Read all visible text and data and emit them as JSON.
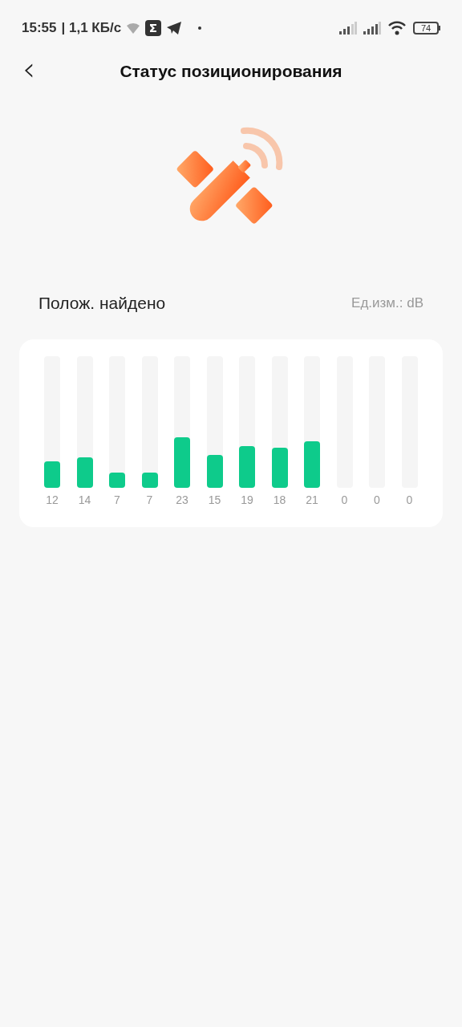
{
  "status_bar": {
    "time": "15:55",
    "speed": "| 1,1 КБ/с",
    "battery": "74"
  },
  "header": {
    "back": "‹",
    "title": "Статус позиционирования"
  },
  "status_row": {
    "label": "Полож. найдено",
    "unit": "Ед.изм.: dB"
  },
  "signal_card": {
    "satellites": [
      {
        "reading": "12",
        "level": 0.2
      },
      {
        "reading": "14",
        "level": 0.23
      },
      {
        "reading": "7",
        "level": 0.115
      },
      {
        "reading": "7",
        "level": 0.115
      },
      {
        "reading": "23",
        "level": 0.38
      },
      {
        "reading": "15",
        "level": 0.25
      },
      {
        "reading": "19",
        "level": 0.315
      },
      {
        "reading": "18",
        "level": 0.3
      },
      {
        "reading": "21",
        "level": 0.35
      },
      {
        "reading": "0",
        "level": 0
      },
      {
        "reading": "0",
        "level": 0
      },
      {
        "reading": "0",
        "level": 0
      }
    ]
  }
}
